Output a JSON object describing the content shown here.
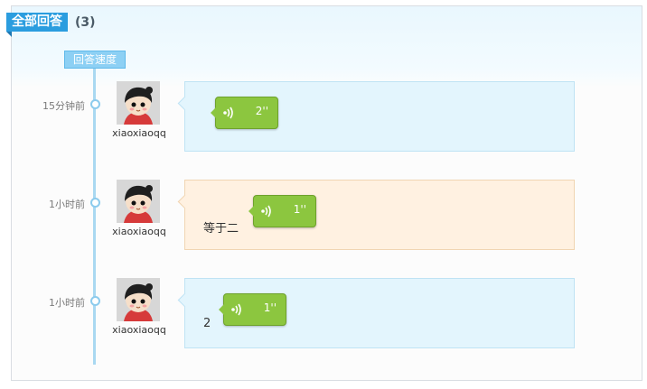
{
  "header": {
    "title": "全部回答",
    "count": "(3)"
  },
  "timeline": {
    "label": "回答速度"
  },
  "answers": [
    {
      "time": "15分钟前",
      "user": "xiaoxiaoqq",
      "duration": "2''",
      "text": "",
      "style": "blue"
    },
    {
      "time": "1小时前",
      "user": "xiaoxiaoqq",
      "duration": "1''",
      "text": "等于二",
      "style": "peach"
    },
    {
      "time": "1小时前",
      "user": "xiaoxiaoqq",
      "duration": "1''",
      "text": "2",
      "style": "blue"
    }
  ],
  "icons": {
    "avatar": "avatar-icon",
    "voice": "audio-wave-icon"
  },
  "colors": {
    "accent": "#2b9ddf",
    "voice_green": "#8cc63f",
    "blue_bubble": "#e3f5fd",
    "peach_bubble": "#fff1e1"
  }
}
